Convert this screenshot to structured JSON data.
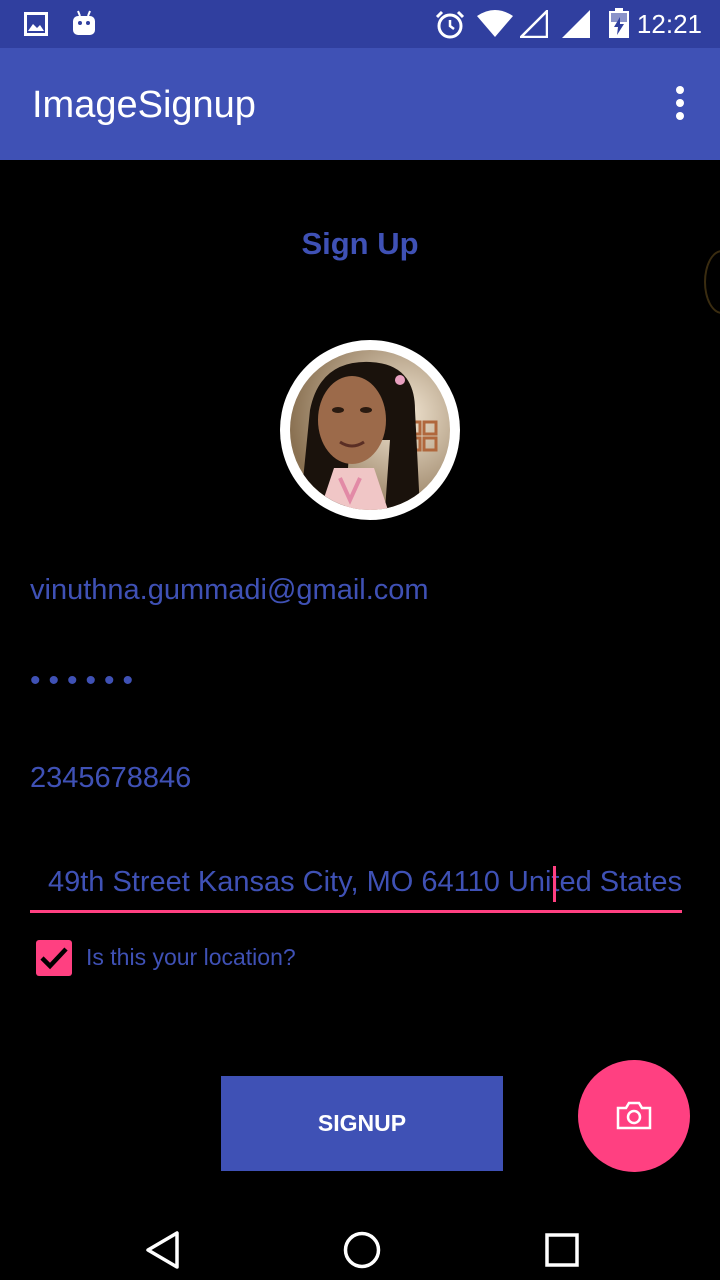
{
  "status_bar": {
    "time": "12:21",
    "icons": [
      "image-icon",
      "android-icon",
      "alarm-icon",
      "wifi-icon",
      "signal-empty-icon",
      "signal-icon",
      "battery-charging-icon"
    ]
  },
  "app_bar": {
    "title": "ImageSignup",
    "menu_icon": "more-vert-icon"
  },
  "form": {
    "heading": "Sign Up",
    "avatar_icon": "profile-photo",
    "email_value": "vinuthna.gummadi@gmail.com",
    "password_value": "••••••",
    "phone_value": "2345678846",
    "address_value": "49th Street Kansas City, MO 64110 United States",
    "location_checkbox_label": "Is this your location?",
    "location_checked": true,
    "signup_button_label": "SIGNUP",
    "fab_icon": "camera-icon"
  },
  "colors": {
    "primary": "#3f51b5",
    "primary_dark": "#303f9f",
    "accent": "#ff4081",
    "background": "#000000"
  },
  "nav_bar": {
    "icons": [
      "back-icon",
      "home-icon",
      "recents-icon"
    ]
  }
}
